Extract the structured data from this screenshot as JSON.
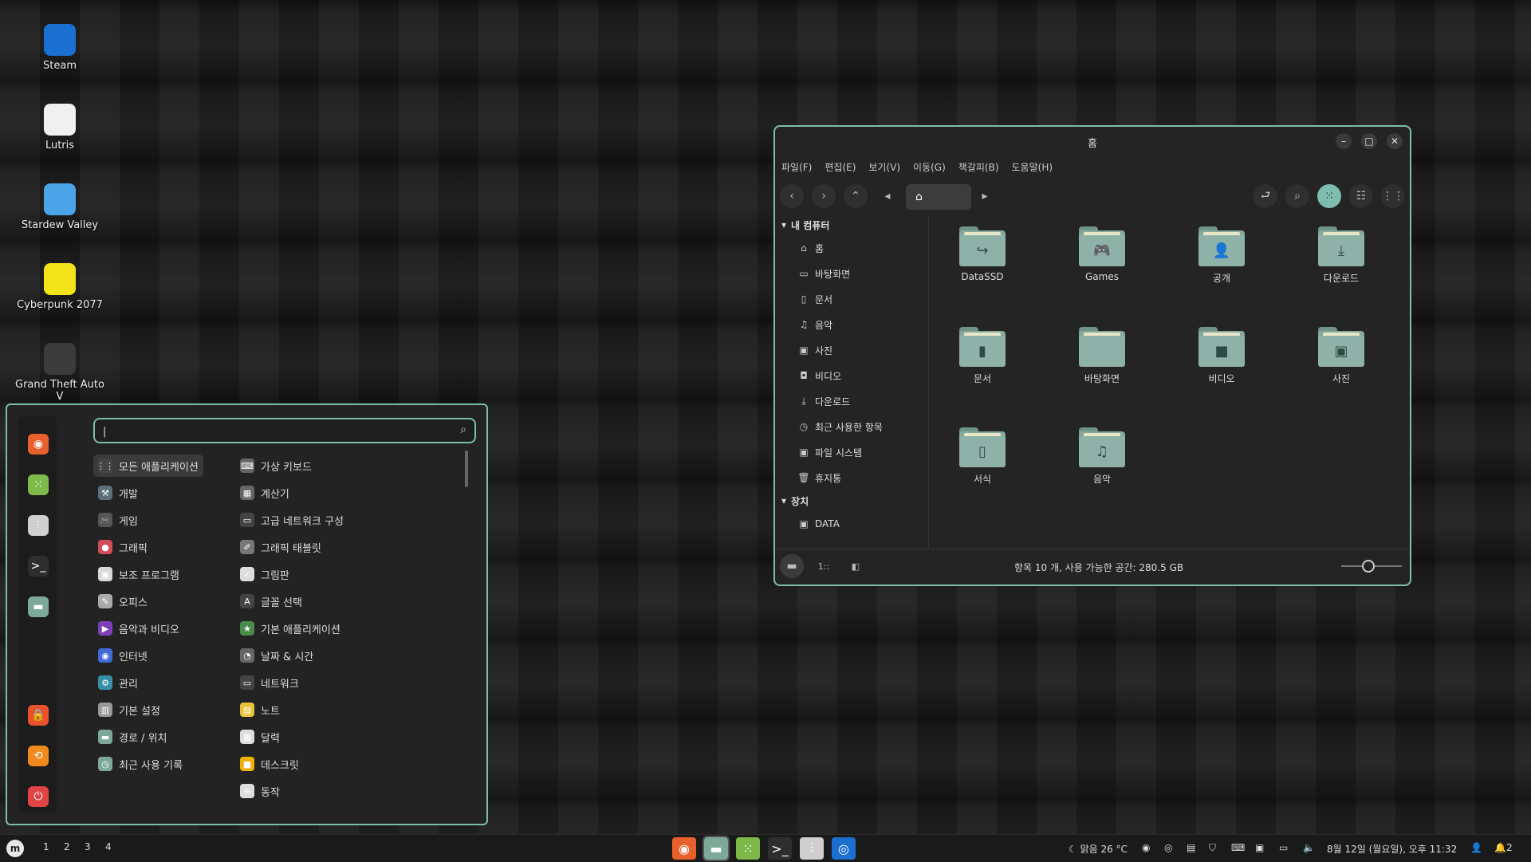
{
  "desktop": {
    "icons": [
      {
        "label": "Steam",
        "icon": "steam-icon",
        "color": "#1b6fd0"
      },
      {
        "label": "Lutris",
        "icon": "lutris-icon",
        "color": "#f0f0f0"
      },
      {
        "label": "Stardew Valley",
        "icon": "stardew-valley-icon",
        "color": "#4ba3e8"
      },
      {
        "label": "Cyberpunk 2077",
        "icon": "cyberpunk-icon",
        "color": "#f2e31a"
      },
      {
        "label": "Grand Theft Auto V",
        "icon": "gta-icon",
        "color": "#3b3b3b"
      }
    ]
  },
  "file_manager": {
    "title": "홈",
    "menu": [
      "파일(F)",
      "편집(E)",
      "보기(V)",
      "이동(G)",
      "책갈피(B)",
      "도움말(H)"
    ],
    "path_icon": "home-icon",
    "sidebar": {
      "section_computer": "내 컴퓨터",
      "items": [
        {
          "label": "홈",
          "icon": "home-icon"
        },
        {
          "label": "바탕화면",
          "icon": "desktop-icon"
        },
        {
          "label": "문서",
          "icon": "document-icon"
        },
        {
          "label": "음악",
          "icon": "music-icon"
        },
        {
          "label": "사진",
          "icon": "picture-icon"
        },
        {
          "label": "비디오",
          "icon": "video-icon"
        },
        {
          "label": "다운로드",
          "icon": "download-icon"
        },
        {
          "label": "최근 사용한 항목",
          "icon": "recent-icon"
        },
        {
          "label": "파일 시스템",
          "icon": "drive-icon"
        },
        {
          "label": "휴지통",
          "icon": "trash-icon"
        }
      ],
      "section_devices": "장치",
      "devices": [
        {
          "label": "DATA",
          "icon": "drive-icon"
        }
      ]
    },
    "files": [
      {
        "label": "DataSSD",
        "emblem": "↪"
      },
      {
        "label": "Games",
        "emblem": "🎮"
      },
      {
        "label": "공개",
        "emblem": "👤"
      },
      {
        "label": "다운로드",
        "emblem": "⤓"
      },
      {
        "label": "문서",
        "emblem": "▮"
      },
      {
        "label": "바탕화면",
        "emblem": ""
      },
      {
        "label": "비디오",
        "emblem": "■"
      },
      {
        "label": "사진",
        "emblem": "▣"
      },
      {
        "label": "서식",
        "emblem": "▯"
      },
      {
        "label": "음악",
        "emblem": "♫"
      }
    ],
    "status": "항목 10 개, 사용 가능한 공간: 280.5 GB",
    "zoom": 0.45
  },
  "app_menu": {
    "search_value": "|",
    "categories_left": [
      {
        "label": "모든 애플리케이션",
        "color": "#444444",
        "glyph": "⋮⋮"
      },
      {
        "label": "개발",
        "color": "#5c6f7a",
        "glyph": "⚒"
      },
      {
        "label": "게임",
        "color": "#555555",
        "glyph": "🎮"
      },
      {
        "label": "그래픽",
        "color": "#d24b5a",
        "glyph": "●"
      },
      {
        "label": "보조 프로그램",
        "color": "#d8d8d8",
        "glyph": "▣"
      },
      {
        "label": "오피스",
        "color": "#aaaaaa",
        "glyph": "✎"
      },
      {
        "label": "음악과 비디오",
        "color": "#7b3fb8",
        "glyph": "▶"
      },
      {
        "label": "인터넷",
        "color": "#3f6bd6",
        "glyph": "◉"
      },
      {
        "label": "관리",
        "color": "#3a8fa8",
        "glyph": "⚙"
      },
      {
        "label": "기본 설정",
        "color": "#999999",
        "glyph": "▥"
      },
      {
        "label": "경로 / 위치",
        "color": "#7daa98",
        "glyph": "▬"
      },
      {
        "label": "최근 사용 기록",
        "color": "#7daa98",
        "glyph": "◷"
      }
    ],
    "categories_right": [
      {
        "label": "가상 키보드",
        "color": "#666666",
        "glyph": "⌨"
      },
      {
        "label": "계산기",
        "color": "#666666",
        "glyph": "▦"
      },
      {
        "label": "고급 네트워크 구성",
        "color": "#444444",
        "glyph": "▭"
      },
      {
        "label": "그래픽 태블릿",
        "color": "#777777",
        "glyph": "✐"
      },
      {
        "label": "그림판",
        "color": "#dddddd",
        "glyph": "✓"
      },
      {
        "label": "글꼴 선택",
        "color": "#444444",
        "glyph": "A"
      },
      {
        "label": "기본 애플리케이션",
        "color": "#4a8a4a",
        "glyph": "★"
      },
      {
        "label": "날짜 & 시간",
        "color": "#666666",
        "glyph": "◔"
      },
      {
        "label": "네트워크",
        "color": "#444444",
        "glyph": "▭"
      },
      {
        "label": "노트",
        "color": "#e8c23a",
        "glyph": "▤"
      },
      {
        "label": "달력",
        "color": "#dddddd",
        "glyph": "▦"
      },
      {
        "label": "데스크릿",
        "color": "#f0b000",
        "glyph": "■"
      },
      {
        "label": "동작",
        "color": "#dddddd",
        "glyph": "≡"
      }
    ],
    "favorites": [
      {
        "icon": "firefox-icon",
        "color": "#e8612c",
        "glyph": "◉"
      },
      {
        "icon": "software-manager-icon",
        "color": "#7fb94a",
        "glyph": "⁙"
      },
      {
        "icon": "system-settings-icon",
        "color": "#cfcfcf",
        "glyph": "⫶"
      },
      {
        "icon": "terminal-icon",
        "color": "#2e2e2e",
        "glyph": ">_"
      },
      {
        "icon": "files-icon",
        "color": "#7daa98",
        "glyph": "▬"
      }
    ],
    "session": [
      {
        "icon": "lock-screen-icon",
        "color": "#e8522c",
        "glyph": "🔒"
      },
      {
        "icon": "logout-icon",
        "color": "#f08a1c",
        "glyph": "⟲"
      },
      {
        "icon": "power-icon",
        "color": "#e04444",
        "glyph": "⏻"
      }
    ]
  },
  "taskbar": {
    "workspaces": [
      "1",
      "2",
      "3",
      "4"
    ],
    "apps": [
      {
        "icon": "firefox-icon",
        "color": "#e8612c",
        "glyph": "◉"
      },
      {
        "icon": "files-icon",
        "color": "#7daa98",
        "glyph": "▬"
      },
      {
        "icon": "software-manager-icon",
        "color": "#7fb94a",
        "glyph": "⁙"
      },
      {
        "icon": "terminal-icon",
        "color": "#2e2e2e",
        "glyph": ">_"
      },
      {
        "icon": "system-settings-icon",
        "color": "#cfcfcf",
        "glyph": "⫶"
      },
      {
        "icon": "steam-icon",
        "color": "#1b6fd0",
        "glyph": "◎"
      }
    ],
    "weather": "맑음 26 °C",
    "clock": "8월 12일 (월요일), 오후 11:32",
    "notifications": "2"
  },
  "colors": {
    "accent": "#7dbdae",
    "folder": "#86a89f"
  }
}
